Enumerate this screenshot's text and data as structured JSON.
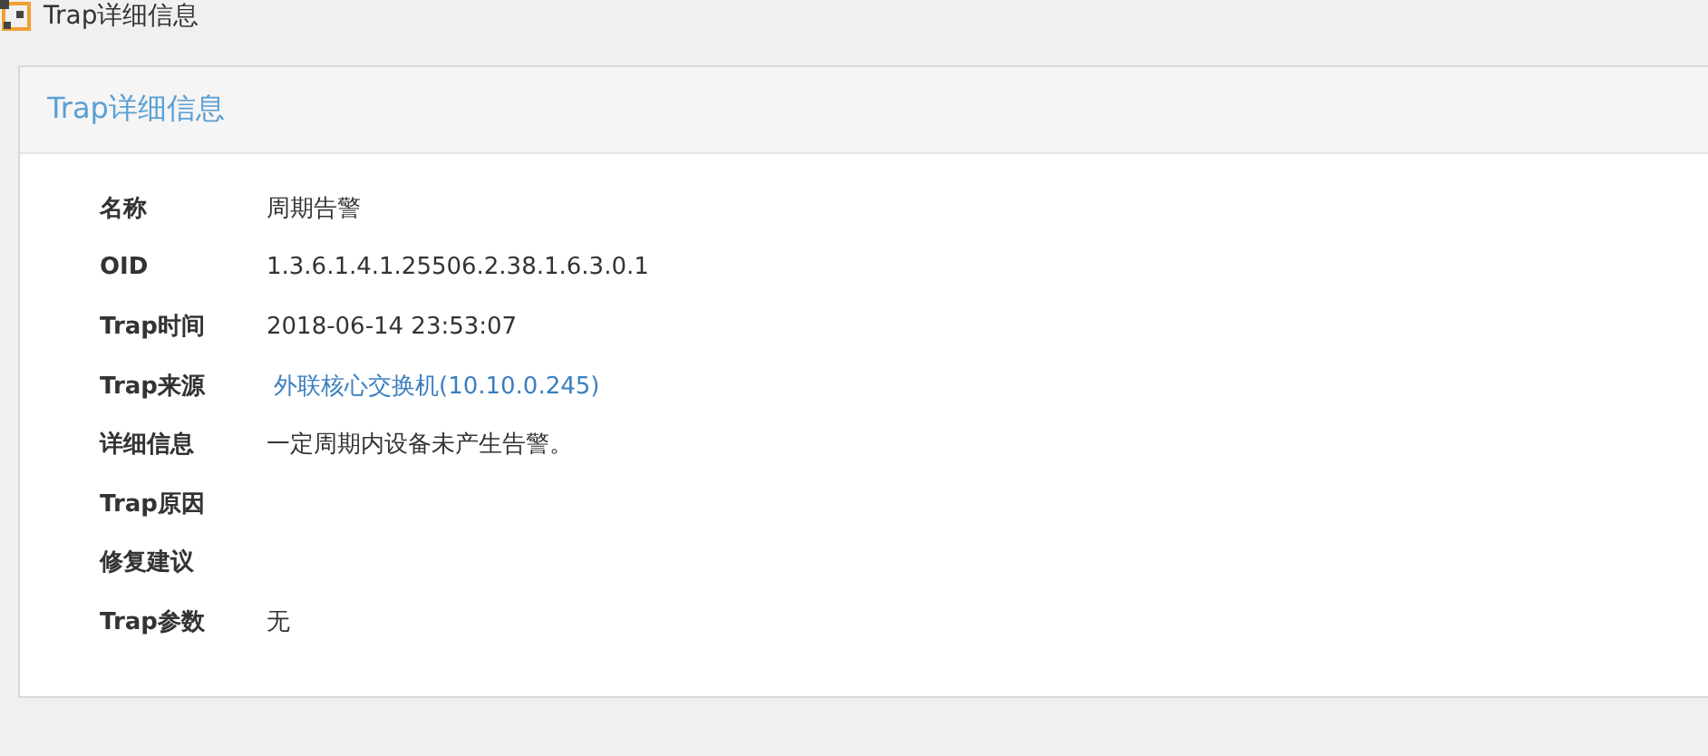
{
  "page_title": "Trap详细信息",
  "panel": {
    "title": "Trap详细信息",
    "rows": [
      {
        "label": "名称",
        "kind": "text",
        "value": "周期告警"
      },
      {
        "label": "OID",
        "kind": "text",
        "value": "1.3.6.1.4.1.25506.2.38.1.6.3.0.1"
      },
      {
        "label": "Trap时间",
        "kind": "text",
        "value": "2018-06-14 23:53:07"
      },
      {
        "label": "Trap来源",
        "kind": "link",
        "value": "外联核心交换机(10.10.0.245)"
      },
      {
        "label": "详细信息",
        "kind": "text",
        "value": "一定周期内设备未产生告警。"
      },
      {
        "label": "Trap原因"
      },
      {
        "label": "修复建议"
      },
      {
        "label": "Trap参数",
        "kind": "text",
        "value": "无"
      }
    ]
  }
}
